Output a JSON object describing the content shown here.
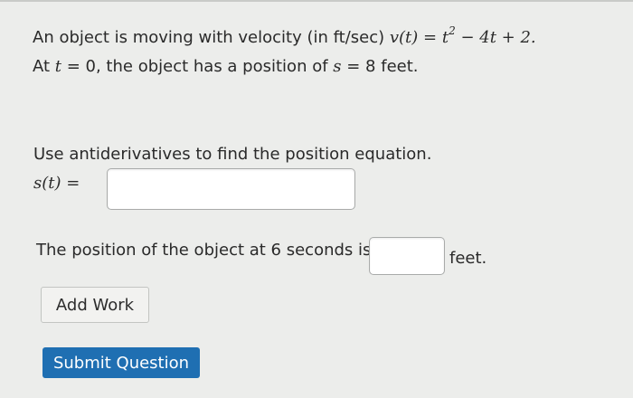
{
  "problem": {
    "line1_prefix": "An object is moving with velocity (in ft/sec) ",
    "velocity_lhs": "v(t)",
    "eq1": " = ",
    "t_var": "t",
    "exponent": "2",
    "velocity_rest": " − 4t + 2.",
    "line2_at": "At ",
    "t_zero": "t",
    "eq2": " = 0, the object has a position of ",
    "s_var": "s",
    "eq3": " = 8 feet."
  },
  "question1": {
    "prompt": "Use antiderivatives to find the position equation.",
    "label": "s(t) =",
    "value": ""
  },
  "question2": {
    "prompt": "The position of the object at 6 seconds is",
    "value": "",
    "unit": "feet."
  },
  "buttons": {
    "add_work": "Add Work",
    "submit": "Submit Question"
  }
}
